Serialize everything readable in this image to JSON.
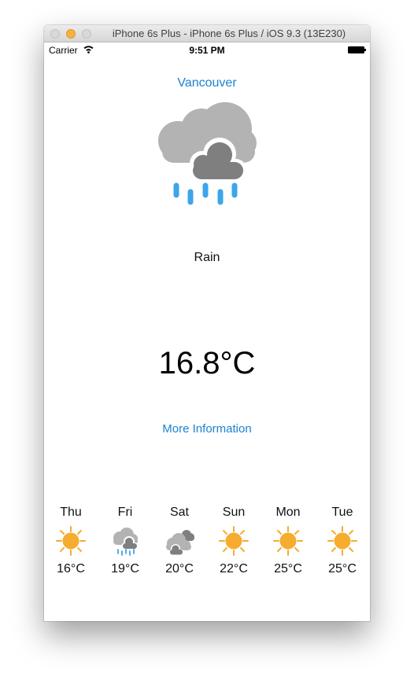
{
  "window": {
    "title": "iPhone 6s Plus - iPhone 6s Plus / iOS 9.3 (13E230)"
  },
  "status_bar": {
    "carrier": "Carrier",
    "time": "9:51 PM"
  },
  "weather": {
    "city": "Vancouver",
    "condition": "Rain",
    "condition_icon": "rain-cloud-icon",
    "temperature": "16.8°C",
    "more_info_label": "More Information"
  },
  "forecast": [
    {
      "day": "Thu",
      "temp": "16°C",
      "icon": "sun-icon"
    },
    {
      "day": "Fri",
      "temp": "19°C",
      "icon": "rain-cloud-icon"
    },
    {
      "day": "Sat",
      "temp": "20°C",
      "icon": "clouds-icon"
    },
    {
      "day": "Sun",
      "temp": "22°C",
      "icon": "sun-icon"
    },
    {
      "day": "Mon",
      "temp": "25°C",
      "icon": "sun-icon"
    },
    {
      "day": "Tue",
      "temp": "25°C",
      "icon": "sun-icon"
    }
  ],
  "colors": {
    "link": "#1a83d2",
    "cloud_light": "#b3b3b3",
    "cloud_dark": "#7f7f7f",
    "rain": "#3da5ea",
    "sun": "#f6ac2f"
  }
}
